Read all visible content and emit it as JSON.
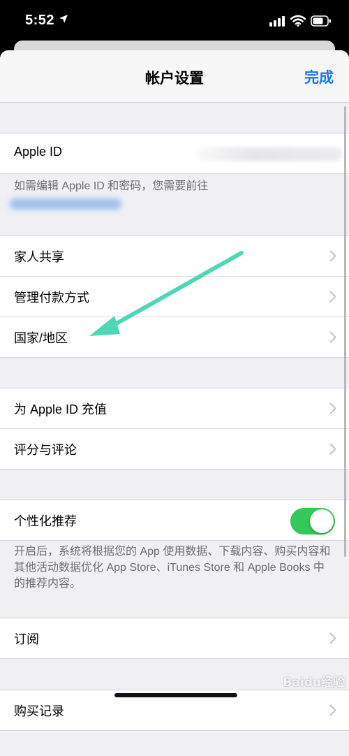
{
  "status_bar": {
    "time": "5:52"
  },
  "nav": {
    "title": "帐户设置",
    "done": "完成"
  },
  "apple_id_group": {
    "label": "Apple ID",
    "note": "如需编辑 Apple ID 和密码，您需要前往"
  },
  "group_family": {
    "items": [
      {
        "label": "家人共享"
      },
      {
        "label": "管理付款方式"
      },
      {
        "label": "国家/地区"
      }
    ]
  },
  "group_topup": {
    "items": [
      {
        "label": "为 Apple ID 充值"
      },
      {
        "label": "评分与评论"
      }
    ]
  },
  "personalization": {
    "label": "个性化推荐",
    "toggle_on": true,
    "note": "开启后，系统将根据您的 App 使用数据、下载内容、购买内容和其他活动数据优化 App Store、iTunes Store 和 Apple Books 中的推荐内容。"
  },
  "subscriptions": {
    "label": "订阅"
  },
  "purchase_history": {
    "label": "购买记录"
  },
  "watermark": "Baidu经验",
  "colors": {
    "accent": "#0a7aff",
    "toggle": "#34c759",
    "arrow": "#4fd6b5"
  },
  "icons": [
    "location-arrow-icon",
    "cellular-signal-icon",
    "wifi-icon",
    "battery-icon",
    "chevron-right-icon"
  ]
}
